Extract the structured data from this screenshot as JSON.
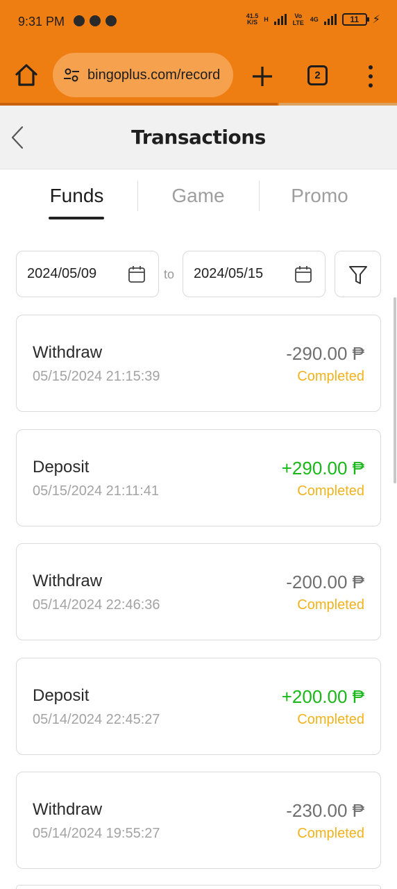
{
  "status_bar": {
    "time": "9:31 PM",
    "net_speed": "41.5",
    "net_unit": "K/S",
    "net_h": "H",
    "volte": "Vo LTE",
    "net_4g": "4G",
    "battery": "11"
  },
  "browser": {
    "url": "bingoplus.com/record",
    "tab_count": "2",
    "colors": {
      "chrome": "#ef7e12",
      "url_pill": "#f6a14e"
    }
  },
  "header": {
    "title": "Transactions"
  },
  "tabs": [
    {
      "label": "Funds",
      "active": true
    },
    {
      "label": "Game",
      "active": false
    },
    {
      "label": "Promo",
      "active": false
    }
  ],
  "filter": {
    "start_date": "2024/05/09",
    "to_label": "to",
    "end_date": "2024/05/15"
  },
  "transactions": [
    {
      "type": "Withdraw",
      "datetime": "05/15/2024 21:15:39",
      "amount": "-290.00 ₱",
      "status": "Completed"
    },
    {
      "type": "Deposit",
      "datetime": "05/15/2024 21:11:41",
      "amount": "+290.00 ₱",
      "status": "Completed"
    },
    {
      "type": "Withdraw",
      "datetime": "05/14/2024 22:46:36",
      "amount": "-200.00 ₱",
      "status": "Completed"
    },
    {
      "type": "Deposit",
      "datetime": "05/14/2024 22:45:27",
      "amount": "+200.00 ₱",
      "status": "Completed"
    },
    {
      "type": "Withdraw",
      "datetime": "05/14/2024 19:55:27",
      "amount": "-230.00 ₱",
      "status": "Completed"
    }
  ],
  "colors": {
    "positive": "#18b818",
    "negative": "#6f6f6f",
    "status_completed": "#f2b21c"
  }
}
